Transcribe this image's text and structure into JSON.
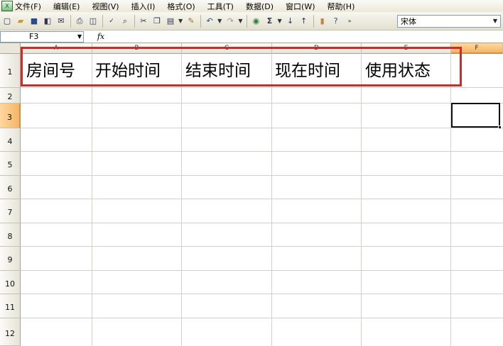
{
  "menubar": {
    "app_icon": "excel-icon",
    "items": [
      "文件(F)",
      "编辑(E)",
      "视图(V)",
      "插入(I)",
      "格式(O)",
      "工具(T)",
      "数据(D)",
      "窗口(W)",
      "帮助(H)"
    ]
  },
  "toolbar": {
    "font_name": "宋体",
    "sigma": "Σ"
  },
  "formula_bar": {
    "name_box": "F3",
    "fx": "fx",
    "content": ""
  },
  "sheet": {
    "columns": [
      "A",
      "B",
      "C",
      "D",
      "E",
      "F"
    ],
    "active_column": "F",
    "rows": [
      "1",
      "2",
      "3",
      "4",
      "5",
      "6",
      "7",
      "8",
      "9",
      "10",
      "11",
      "12"
    ],
    "active_row": "3",
    "header_cells": [
      "房间号",
      "开始时间",
      "结束时间",
      "现在时间",
      "使用状态"
    ],
    "highlight_color": "#d12a2a"
  }
}
